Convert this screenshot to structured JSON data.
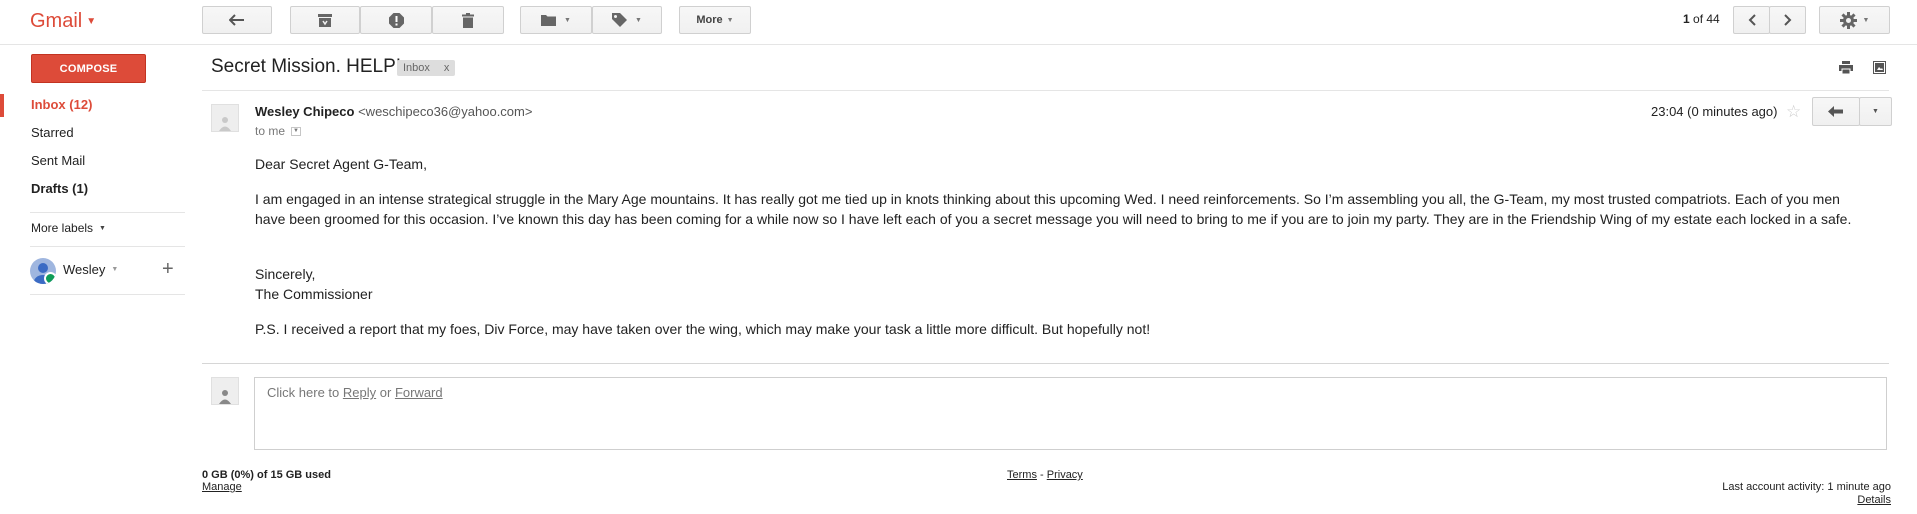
{
  "app": {
    "logo": "Gmail"
  },
  "toolbar": {
    "more_label": "More",
    "pager_current": "1",
    "pager_of": "of 44"
  },
  "sidebar": {
    "compose_label": "COMPOSE",
    "items": [
      {
        "label": "Inbox (12)"
      },
      {
        "label": "Starred"
      },
      {
        "label": "Sent Mail"
      },
      {
        "label": "Drafts (1)"
      }
    ],
    "more_labels": "More labels",
    "user_name": "Wesley"
  },
  "message": {
    "subject": "Secret Mission. HELP!",
    "label": "Inbox",
    "label_remove": "x",
    "sender_name": "Wesley Chipeco",
    "sender_email": "<weschipeco36@yahoo.com>",
    "to": "to me",
    "time": "23:04 (0 minutes ago)",
    "greeting": "Dear Secret Agent G-Team,",
    "para1": "I am engaged in an intense strategical struggle in the Mary Age mountains. It has really got me tied up in knots thinking about this upcoming Wed. I need reinforcements. So I’m assembling you all, the G-Team, my most trusted compatriots. Each of you men have been groomed for this occasion. I’ve known this day has been coming for a while now so I have left each of you a secret message you will need to bring to me if you are to join my party. They are in the Friendship Wing of my estate each locked in a safe.",
    "signoff": "Sincerely,",
    "signature": "The Commissioner",
    "ps": "P.S. I received a report that my foes, Div Force, may have taken over the wing, which may make your task a little more difficult. But hopefully not!"
  },
  "reply": {
    "prefix": "Click here to",
    "reply_link": "Reply",
    "or": "or",
    "forward_link": "Forward"
  },
  "footer": {
    "storage": "0 GB (0%) of 15 GB used",
    "manage": "Manage",
    "terms": "Terms",
    "sep": "-",
    "privacy": "Privacy",
    "activity": "Last account activity: 1 minute ago",
    "details": "Details"
  },
  "colors": {
    "brand_red": "#dd4b39",
    "online_green": "#0f9d58"
  },
  "icons": [
    "back-arrow-icon",
    "archive-icon",
    "report-spam-icon",
    "trash-icon",
    "folder-icon",
    "label-icon",
    "chevron-left-icon",
    "chevron-right-icon",
    "gear-icon",
    "print-icon",
    "new-window-icon",
    "star-icon",
    "reply-icon",
    "person-icon",
    "plus-icon"
  ]
}
